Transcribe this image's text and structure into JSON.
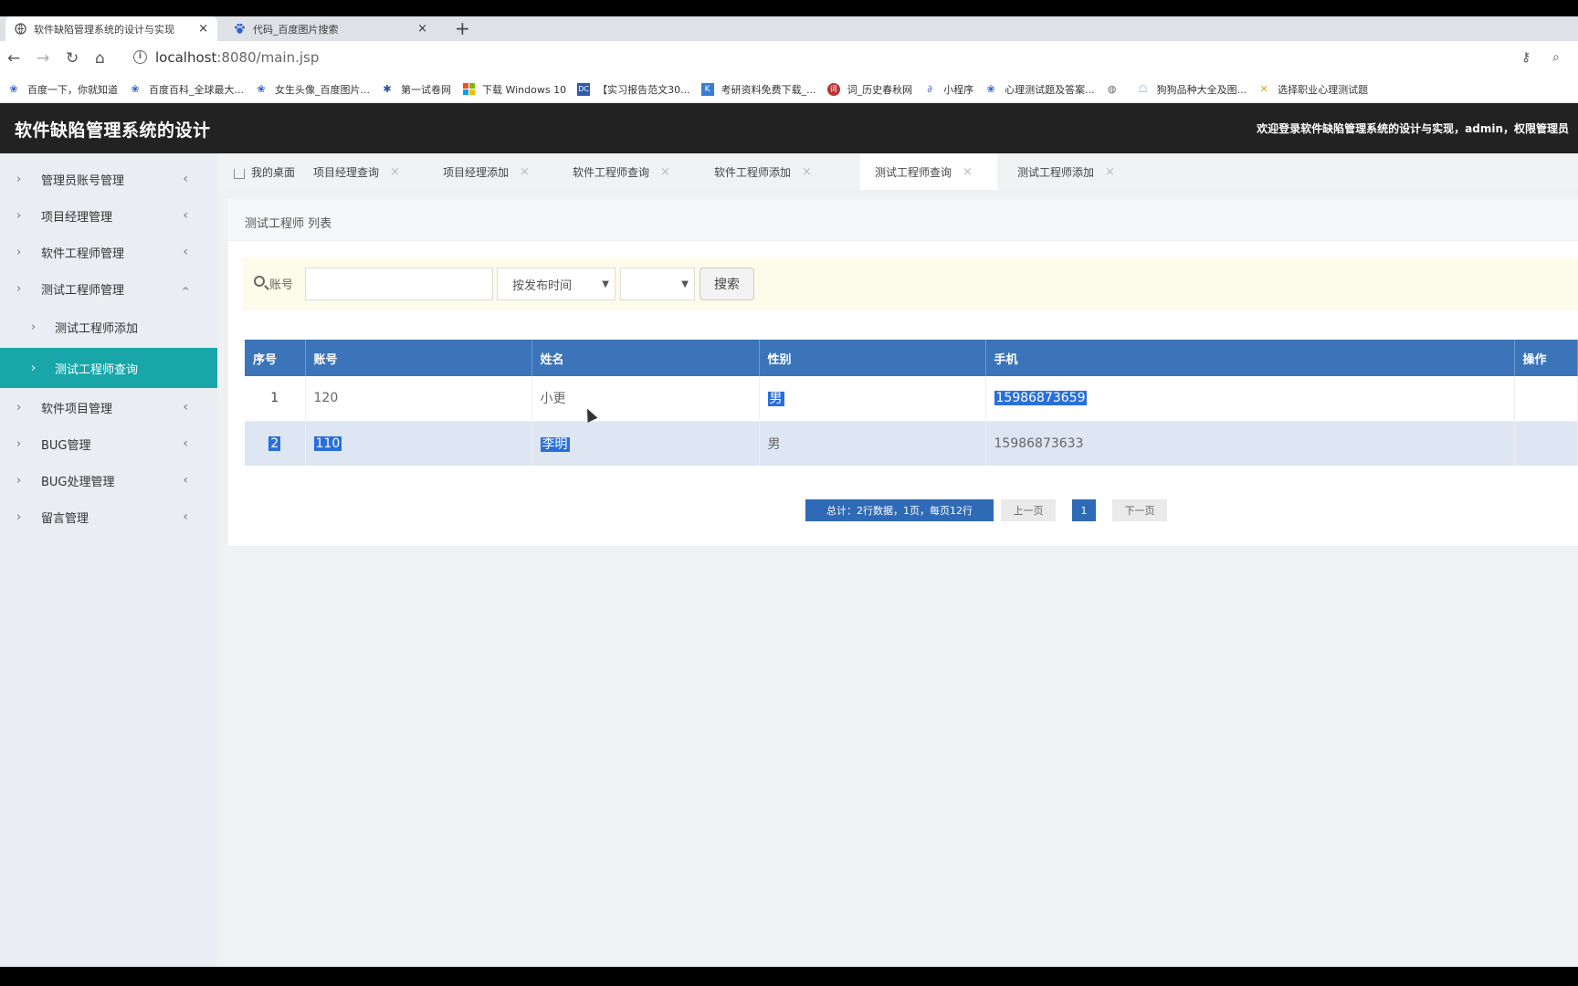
{
  "browser": {
    "tabs": [
      {
        "title": "软件缺陷管理系统的设计与实现",
        "close": "×"
      },
      {
        "title": "代码_百度图片搜索",
        "close": "×"
      }
    ],
    "new_tab": "+",
    "url_host": "localhost",
    "url_rest": ":8080/main.jsp",
    "bookmarks": [
      "百度一下，你就知道",
      "百度百科_全球最大...",
      "女生头像_百度图片...",
      "第一试卷网",
      "下载 Windows 10",
      "【实习报告范文30...",
      "考研资料免费下载_...",
      "词_历史春秋网",
      "小程序",
      "心理测试题及答案...",
      "",
      "狗狗品种大全及图...",
      "选择职业心理测试题"
    ]
  },
  "app": {
    "title": "软件缺陷管理系统的设计",
    "welcome": "欢迎登录软件缺陷管理系统的设计与实现，admin，权限管理员"
  },
  "sidebar": {
    "items": [
      {
        "label": "管理员账号管理"
      },
      {
        "label": "项目经理管理"
      },
      {
        "label": "软件工程师管理"
      },
      {
        "label": "测试工程师管理"
      },
      {
        "label": "测试工程师添加"
      },
      {
        "label": "测试工程师查询"
      },
      {
        "label": "软件项目管理"
      },
      {
        "label": "BUG管理"
      },
      {
        "label": "BUG处理管理"
      },
      {
        "label": "留言管理"
      }
    ]
  },
  "content_tabs": [
    {
      "label": "我的桌面"
    },
    {
      "label": "项目经理查询"
    },
    {
      "label": "项目经理添加"
    },
    {
      "label": "软件工程师查询"
    },
    {
      "label": "软件工程师添加"
    },
    {
      "label": "测试工程师查询"
    },
    {
      "label": "测试工程师添加"
    }
  ],
  "panel": {
    "title": "测试工程师 列表",
    "search": {
      "label": "账号",
      "input_value": "",
      "sort_select": "按发布时间",
      "order_select": "",
      "button": "搜索"
    },
    "table": {
      "headers": [
        "序号",
        "账号",
        "姓名",
        "性别",
        "手机",
        "操作"
      ],
      "rows": [
        {
          "idx": "1",
          "account": "120",
          "name": "小更",
          "gender": "男",
          "phone": "15986873659",
          "action": ""
        },
        {
          "idx": "2",
          "account": "110",
          "name": "李明",
          "gender": "男",
          "phone": "15986873633",
          "action": ""
        }
      ]
    },
    "pager": {
      "total": "总计：2行数据，1页，每页12行",
      "prev": "上一页",
      "current": "1",
      "next": "下一页"
    }
  }
}
